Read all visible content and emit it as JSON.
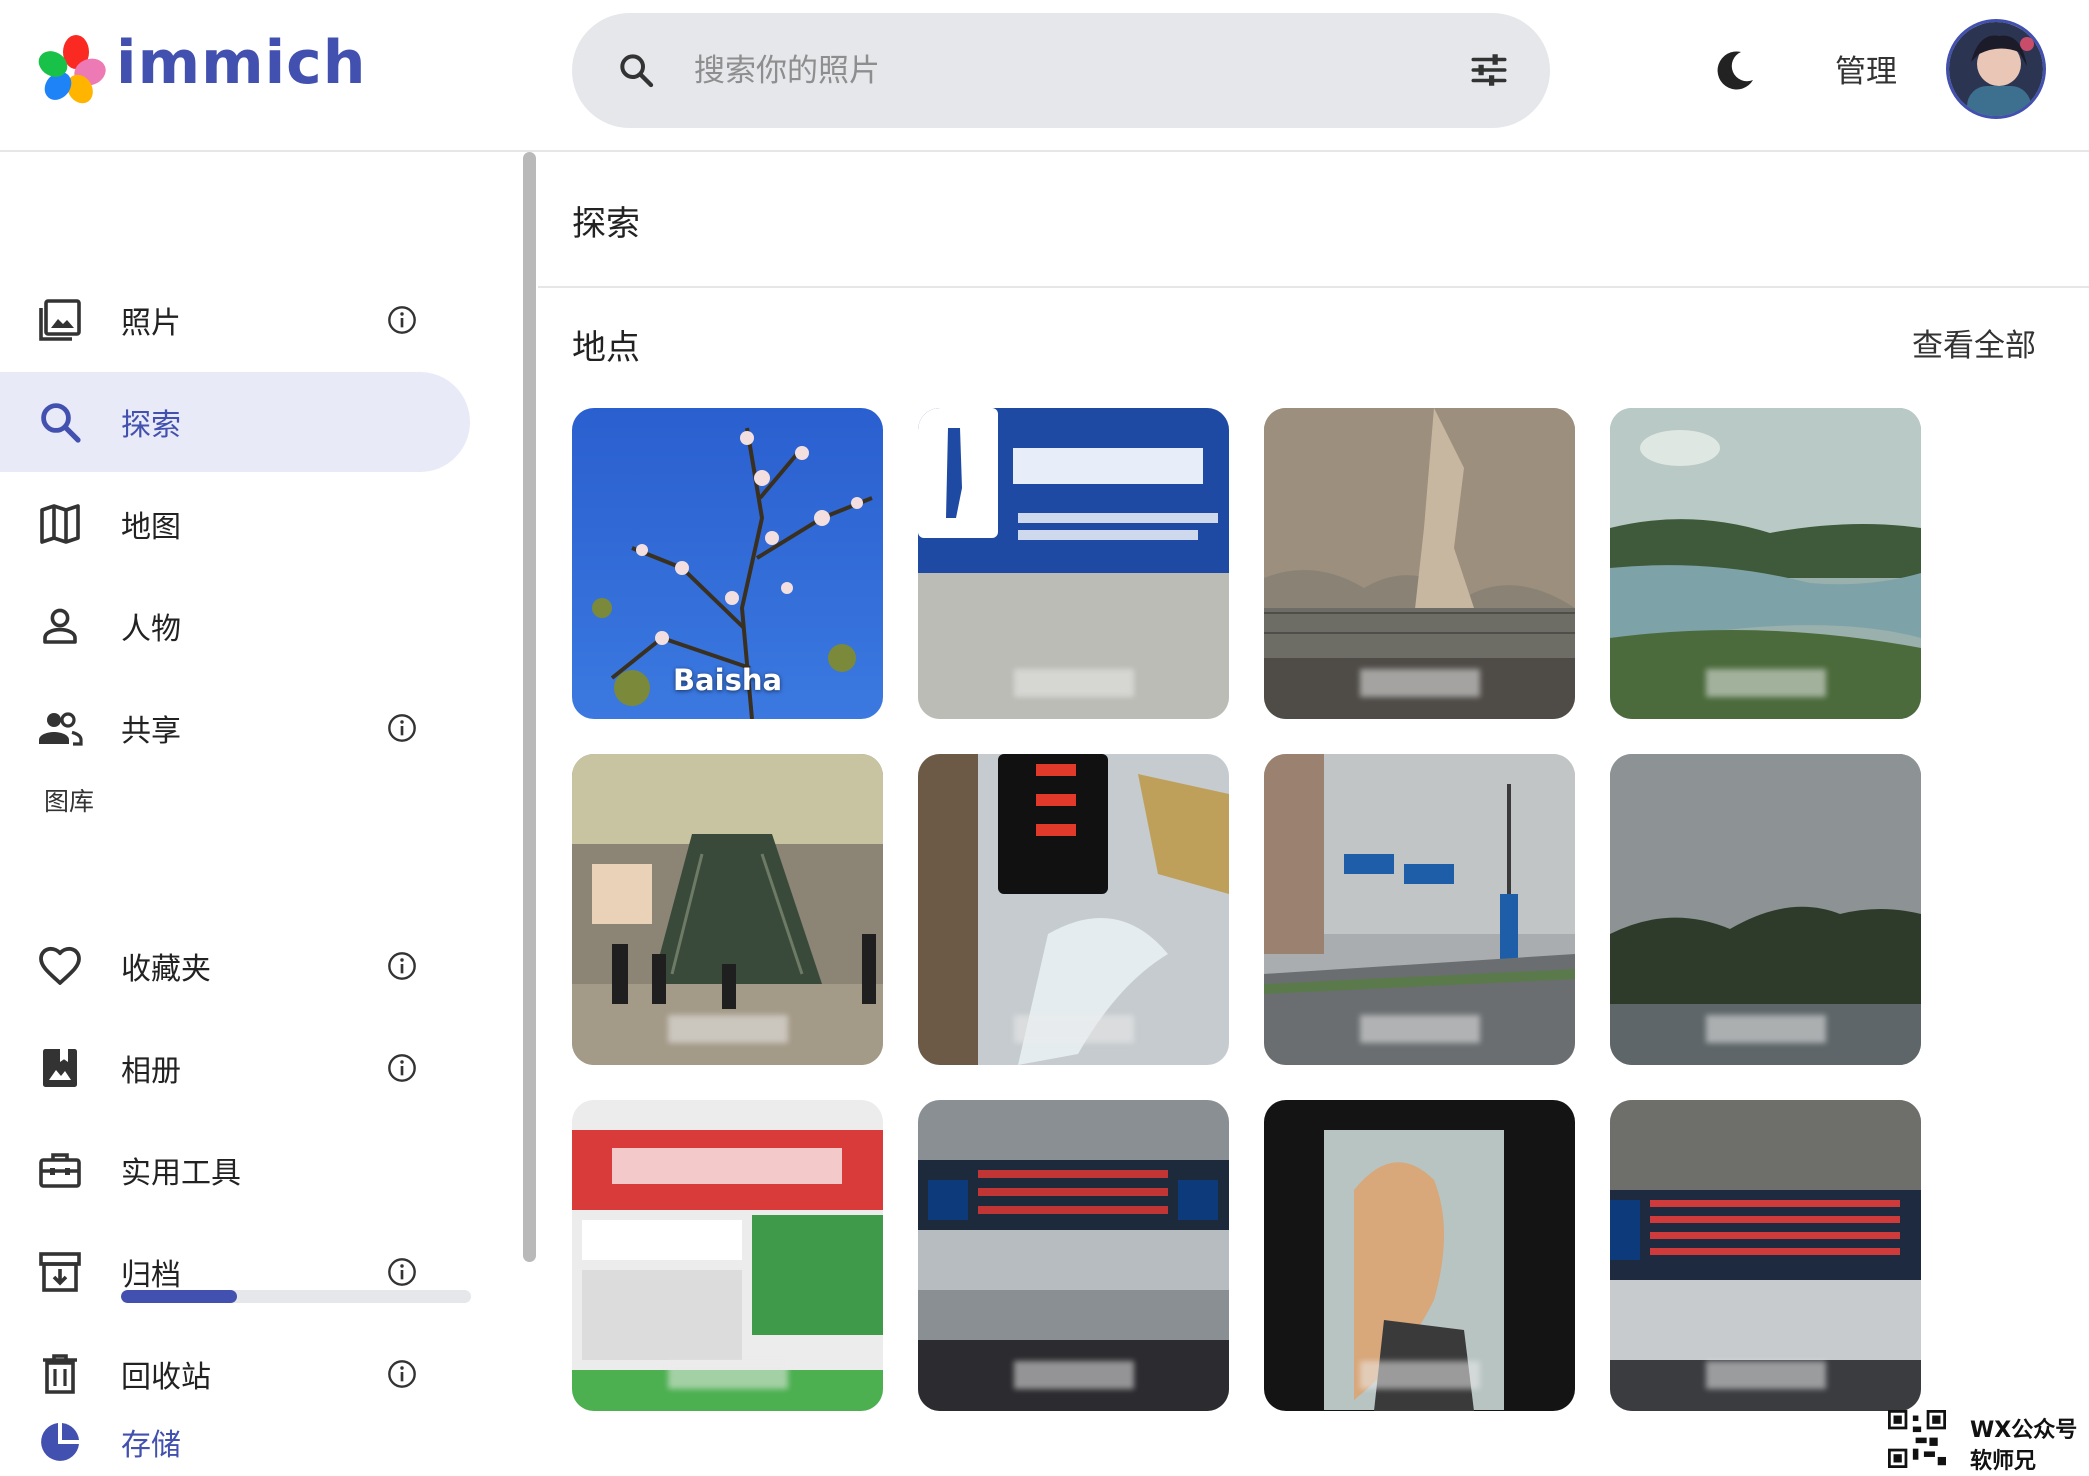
{
  "app": {
    "name": "immich"
  },
  "header": {
    "search_placeholder": "搜索你的照片",
    "admin_label": "管理"
  },
  "sidebar": {
    "items": [
      {
        "label": "照片",
        "icon": "photos-icon",
        "info": true
      },
      {
        "label": "探索",
        "icon": "search-icon",
        "info": false,
        "active": true
      },
      {
        "label": "地图",
        "icon": "map-icon",
        "info": false
      },
      {
        "label": "人物",
        "icon": "person-icon",
        "info": false
      },
      {
        "label": "共享",
        "icon": "people-icon",
        "info": true
      }
    ],
    "library_label": "图库",
    "library_items": [
      {
        "label": "收藏夹",
        "icon": "heart-icon",
        "info": true
      },
      {
        "label": "相册",
        "icon": "album-icon",
        "info": true
      },
      {
        "label": "实用工具",
        "icon": "toolbox-icon",
        "info": false
      },
      {
        "label": "归档",
        "icon": "archive-icon",
        "info": true
      },
      {
        "label": "回收站",
        "icon": "trash-icon",
        "info": true
      }
    ],
    "storage": {
      "label": "存储",
      "used_fraction": 0.33
    }
  },
  "main": {
    "title": "探索",
    "places": {
      "title": "地点",
      "view_all": "查看全部",
      "tiles": [
        {
          "name": "Baisha"
        },
        {
          "name": ""
        },
        {
          "name": ""
        },
        {
          "name": ""
        },
        {
          "name": ""
        },
        {
          "name": ""
        },
        {
          "name": ""
        },
        {
          "name": ""
        },
        {
          "name": ""
        },
        {
          "name": ""
        },
        {
          "name": ""
        },
        {
          "name": ""
        }
      ]
    }
  },
  "watermark": {
    "line1": "WX公众号",
    "line2": "软师兄"
  },
  "colors": {
    "accent": "#4250af",
    "active_bg": "#e8eaf7",
    "search_bg": "#e5e7eb"
  }
}
